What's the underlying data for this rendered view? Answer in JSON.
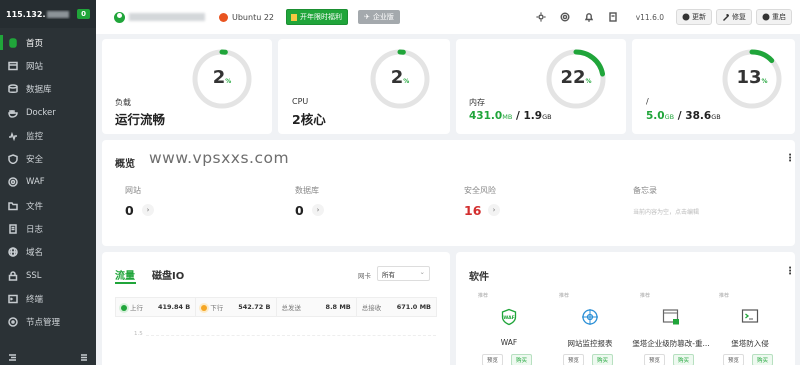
{
  "sidebar": {
    "ip": "115.132.",
    "count": "0",
    "items": [
      {
        "label": "首页",
        "icon": "home-icon"
      },
      {
        "label": "网站",
        "icon": "globe-icon"
      },
      {
        "label": "数据库",
        "icon": "database-icon"
      },
      {
        "label": "Docker",
        "icon": "docker-icon"
      },
      {
        "label": "监控",
        "icon": "monitor-icon"
      },
      {
        "label": "安全",
        "icon": "shield-icon"
      },
      {
        "label": "WAF",
        "icon": "waf-icon"
      },
      {
        "label": "文件",
        "icon": "folder-icon"
      },
      {
        "label": "日志",
        "icon": "log-icon"
      },
      {
        "label": "域名",
        "icon": "domain-icon"
      },
      {
        "label": "SSL",
        "icon": "ssl-icon"
      },
      {
        "label": "终端",
        "icon": "terminal-icon"
      },
      {
        "label": "节点管理",
        "icon": "node-icon"
      }
    ]
  },
  "topbar": {
    "os": "Ubuntu 22",
    "promo": "开年限时福利",
    "enterprise": "企业版",
    "version": "v11.6.0",
    "update": "更新",
    "repair": "修复",
    "restart": "重启"
  },
  "stats": {
    "load": {
      "label": "负载",
      "status": "运行流畅",
      "percent": "2",
      "pct_sign": "%",
      "ratio": 0.02
    },
    "cpu": {
      "label": "CPU",
      "cores": "2核心",
      "percent": "2",
      "pct_sign": "%",
      "ratio": 0.02
    },
    "memory": {
      "label": "内存",
      "used": "431.0",
      "used_unit": "MB",
      "total": "1.9",
      "total_unit": "GB",
      "sep": " / ",
      "percent": "22",
      "pct_sign": "%",
      "ratio": 0.22
    },
    "disk": {
      "label": "/",
      "used": "5.0",
      "used_unit": "GB",
      "total": "38.6",
      "total_unit": "GB",
      "sep": " / ",
      "percent": "13",
      "pct_sign": "%",
      "ratio": 0.13
    }
  },
  "overview": {
    "title": "概览",
    "watermark": "www.vpsxxs.com",
    "items": [
      {
        "label": "网站",
        "value": "0"
      },
      {
        "label": "数据库",
        "value": "0"
      },
      {
        "label": "安全风险",
        "value": "16"
      },
      {
        "label": "备忘录",
        "note": "当前内容为空，点击编辑"
      }
    ]
  },
  "traffic": {
    "tab_traffic": "流量",
    "tab_disk": "磁盘IO",
    "nic_label": "网卡",
    "nic_value": "所有",
    "upload_label": "上行",
    "upload_value": "419.84 B",
    "download_label": "下行",
    "download_value": "542.72 B",
    "sent_label": "总发送",
    "sent_value": "8.8 MB",
    "recv_label": "总接收",
    "recv_value": "671.0 MB",
    "axis_top": "1.5"
  },
  "software": {
    "title": "软件",
    "items": [
      {
        "tag": "推荐",
        "name": "WAF",
        "preview": "预览",
        "buy": "购买",
        "icon": "waf-shield-icon"
      },
      {
        "tag": "推荐",
        "name": "网站监控报表",
        "preview": "预览",
        "buy": "购买",
        "icon": "monitor-report-icon"
      },
      {
        "tag": "推荐",
        "name": "堡塔企业级防篡改-重...",
        "preview": "预览",
        "buy": "购买",
        "icon": "tamper-proof-icon"
      },
      {
        "tag": "推荐",
        "name": "堡塔防入侵",
        "preview": "预览",
        "buy": "购买",
        "icon": "intrusion-icon"
      }
    ]
  },
  "colors": {
    "accent": "#20a53a",
    "danger": "#d32f2f",
    "sidebar": "#2b3236"
  }
}
